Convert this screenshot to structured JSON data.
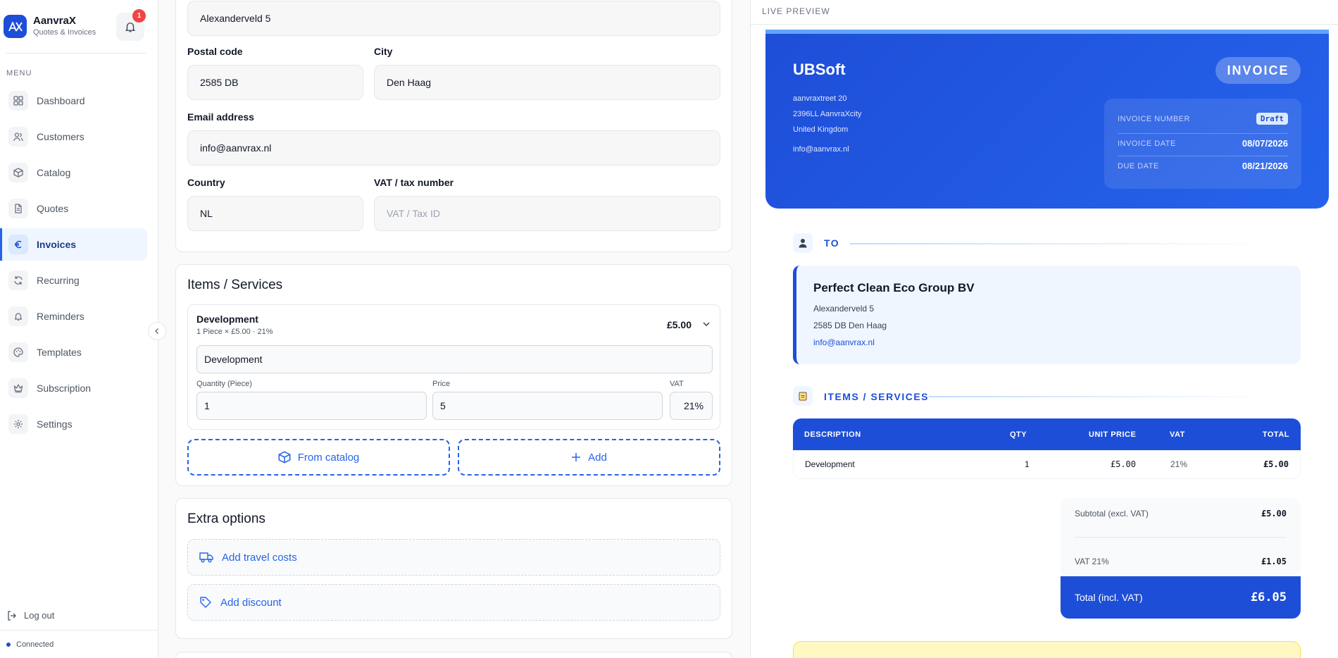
{
  "app": {
    "name": "AanvraX",
    "subtitle": "Quotes & Invoices",
    "notification_count": "1"
  },
  "sidebar": {
    "menu_label": "MENU",
    "items": [
      {
        "label": "Dashboard",
        "icon": "grid-icon"
      },
      {
        "label": "Customers",
        "icon": "users-icon"
      },
      {
        "label": "Catalog",
        "icon": "box-icon"
      },
      {
        "label": "Quotes",
        "icon": "document-icon"
      },
      {
        "label": "Invoices",
        "icon": "euro-icon",
        "active": true
      },
      {
        "label": "Recurring",
        "icon": "refresh-icon"
      },
      {
        "label": "Reminders",
        "icon": "bell-icon"
      },
      {
        "label": "Templates",
        "icon": "palette-icon"
      },
      {
        "label": "Subscription",
        "icon": "crown-icon"
      },
      {
        "label": "Settings",
        "icon": "gear-icon"
      }
    ],
    "logout": "Log out",
    "status": "Connected"
  },
  "form": {
    "address": "Alexanderveld 5",
    "postal_code_label": "Postal code",
    "postal_code": "2585 DB",
    "city_label": "City",
    "city": "Den Haag",
    "email_label": "Email address",
    "email": "info@aanvrax.nl",
    "country_label": "Country",
    "country": "NL",
    "vat_label": "VAT / tax number",
    "vat_placeholder": "VAT / Tax ID"
  },
  "items_section": {
    "title": "Items / Services",
    "item": {
      "name": "Development",
      "summary": "1 Piece × £5.00 · 21%",
      "total": "£5.00",
      "description": "Development",
      "qty_label": "Quantity (Piece)",
      "qty": "1",
      "price_label": "Price",
      "price": "5",
      "vat_label": "VAT",
      "vat": "21%"
    },
    "from_catalog": "From catalog",
    "add": "Add"
  },
  "extra_options": {
    "title": "Extra options",
    "travel": "Add travel costs",
    "discount": "Add discount"
  },
  "preview": {
    "label": "LIVE PREVIEW",
    "company": {
      "name": "UBSoft",
      "street": "aanvraxtreet 20",
      "city_line": "2396LL AanvraXcity",
      "country": "United Kingdom",
      "email": "info@aanvrax.nl"
    },
    "doc_type": "INVOICE",
    "meta": {
      "number_label": "INVOICE NUMBER",
      "number_value": "Draft",
      "date_label": "INVOICE DATE",
      "date_value": "08/07/2026",
      "due_label": "DUE DATE",
      "due_value": "08/21/2026"
    },
    "to_label": "TO",
    "client": {
      "name": "Perfect Clean Eco Group BV",
      "street": "Alexanderveld 5",
      "city_line": "2585 DB Den Haag",
      "email": "info@aanvrax.nl"
    },
    "items_label": "ITEMS / SERVICES",
    "table": {
      "headers": {
        "description": "DESCRIPTION",
        "qty": "QTY",
        "unit_price": "UNIT PRICE",
        "vat": "VAT",
        "total": "TOTAL"
      },
      "rows": [
        {
          "description": "Development",
          "qty": "1",
          "unit_price": "£5.00",
          "vat": "21%",
          "total": "£5.00"
        }
      ]
    },
    "totals": {
      "subtotal_label": "Subtotal (excl. VAT)",
      "subtotal": "£5.00",
      "vat_label": "VAT 21%",
      "vat": "£1.05",
      "total_label": "Total (incl. VAT)",
      "total": "£6.05"
    }
  },
  "colors": {
    "accent": "#1d4ed8",
    "badge": "#ef4444"
  }
}
